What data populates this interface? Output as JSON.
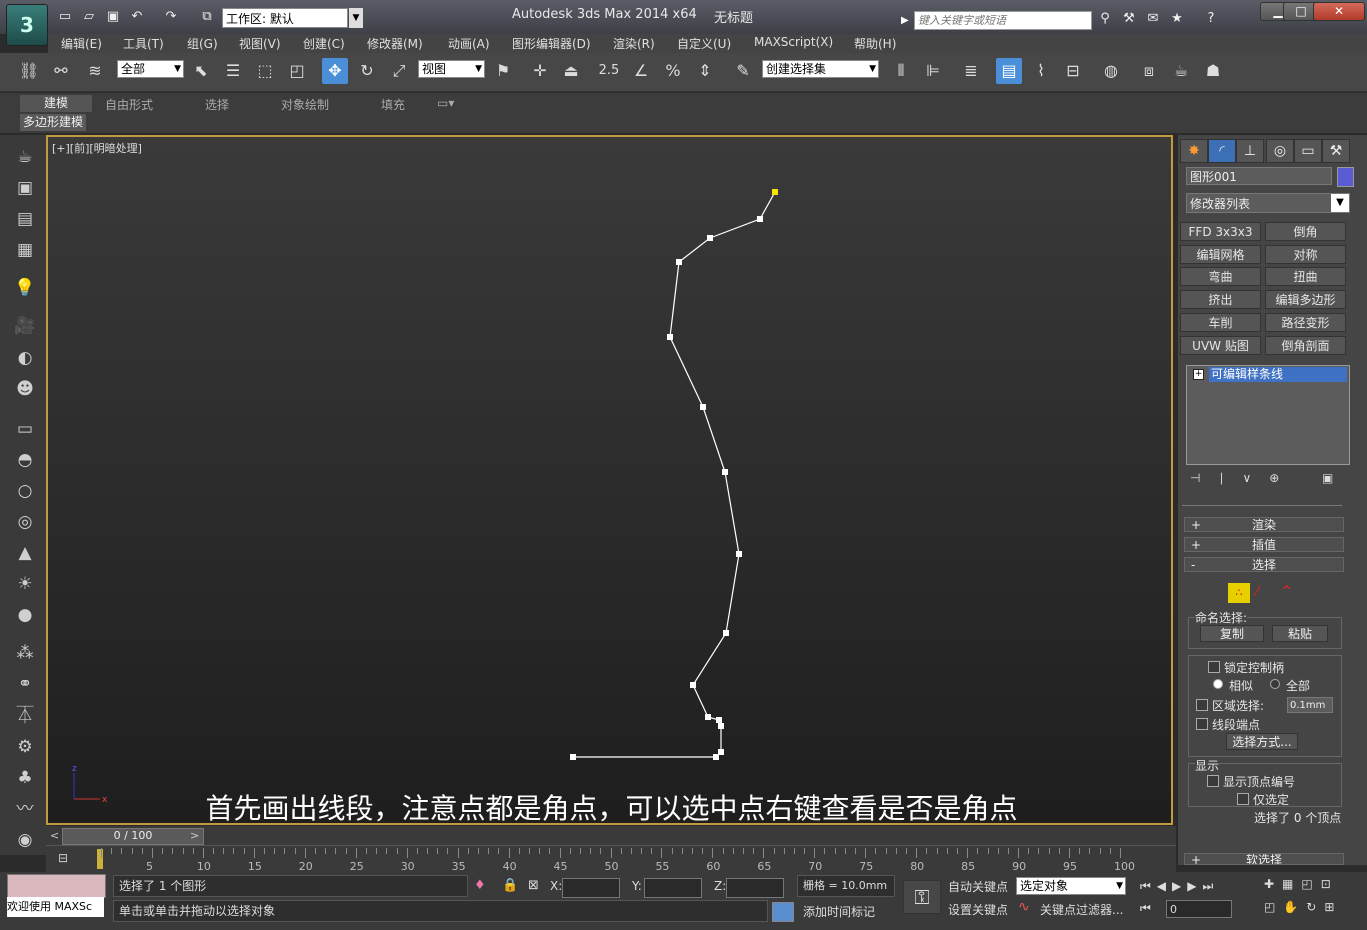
{
  "title_bar": {
    "app_title": "Autodesk 3ds Max  2014 x64",
    "doc_title": "无标题",
    "workspace": "工作区: 默认",
    "search_placeholder": "键入关键字或短语",
    "minimize": "▁",
    "maximize": "□",
    "close": "✕"
  },
  "menu": [
    "编辑(E)",
    "工具(T)",
    "组(G)",
    "视图(V)",
    "创建(C)",
    "修改器(M)",
    "动画(A)",
    "图形编辑器(D)",
    "渲染(R)",
    "自定义(U)",
    "MAXScript(X)",
    "帮助(H)"
  ],
  "toolbar": {
    "selection_filter": "全部",
    "ref_coord": "视图",
    "named_selection": "创建选择集",
    "snap_label": "2.5"
  },
  "ribbon": {
    "tabs": [
      "建模",
      "自由形式",
      "选择",
      "对象绘制",
      "填充"
    ],
    "active_tab": "建模",
    "panel": "多边形建模"
  },
  "viewport": {
    "label": "[+][前][明暗处理]",
    "subtitle": "首先画出线段，注意点都是角点，可以选中点右键查看是否是角点",
    "spline_points": [
      [
        773,
        190
      ],
      [
        758,
        217
      ],
      [
        708,
        236
      ],
      [
        677,
        260
      ],
      [
        668,
        335
      ],
      [
        701,
        405
      ],
      [
        723,
        470
      ],
      [
        737,
        552
      ],
      [
        724,
        631
      ],
      [
        691,
        683
      ],
      [
        706,
        715
      ],
      [
        717,
        718
      ],
      [
        719,
        724
      ],
      [
        719,
        750
      ],
      [
        714,
        755
      ],
      [
        571,
        755
      ]
    ]
  },
  "time_slider": {
    "label": "0 / 100",
    "ticks": [
      "0",
      "5",
      "10",
      "15",
      "20",
      "25",
      "30",
      "35",
      "40",
      "45",
      "50",
      "55",
      "60",
      "65",
      "70",
      "75",
      "80",
      "85",
      "90",
      "95",
      "100"
    ]
  },
  "status": {
    "maxscript": "欢迎使用 MAXSc",
    "selected": "选择了 1 个图形",
    "prompt": "单击或单击并拖动以选择对象",
    "x_label": "X:",
    "y_label": "Y:",
    "z_label": "Z:",
    "grid": "栅格 = 10.0mm",
    "add_time_tag": "添加时间标记",
    "auto_key": "自动关键点",
    "set_key": "设置关键点",
    "selected_object": "选定对象",
    "key_filters": "关键点过滤器...",
    "frame": "0"
  },
  "command_panel": {
    "object_name": "图形001",
    "object_color": "#5a5ad2",
    "modifier_list": "修改器列表",
    "modifier_buttons": [
      "FFD 3x3x3",
      "倒角",
      "编辑网格",
      "对称",
      "弯曲",
      "扭曲",
      "挤出",
      "编辑多边形",
      "车削",
      "路径变形",
      "UVW 贴图",
      "倒角剖面"
    ],
    "stack_item": "可编辑样条线",
    "rollouts": [
      {
        "sign": "+",
        "label": "渲染"
      },
      {
        "sign": "+",
        "label": "插值"
      },
      {
        "sign": "-",
        "label": "选择"
      }
    ],
    "named_selection_label": "命名选择:",
    "copy": "复制",
    "paste": "粘贴",
    "lock_handles": "锁定控制柄",
    "alike": "相似",
    "all": "全部",
    "area_selection": "区域选择:",
    "area_value": "0.1mm",
    "segment_end": "线段端点",
    "select_by": "选择方式...",
    "display_label": "显示",
    "show_vertex_numbers": "显示顶点编号",
    "selected_only": "仅选定",
    "vertices_selected": "选择了 0 个顶点",
    "soft_selection": "软选择"
  }
}
